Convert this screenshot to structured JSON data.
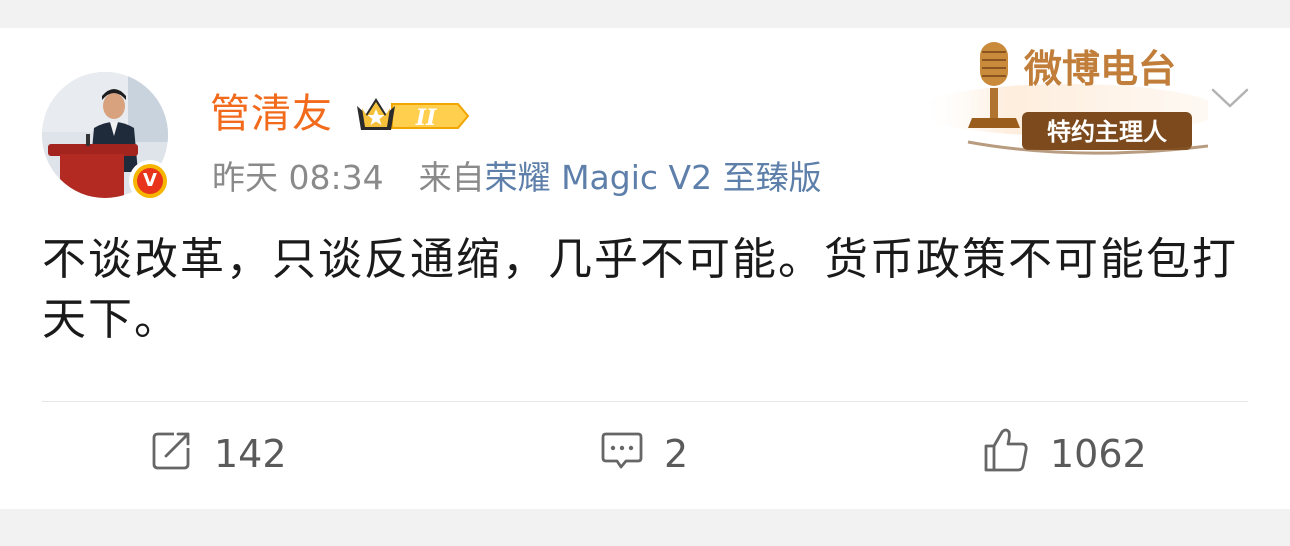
{
  "post": {
    "username": "管清友",
    "time": "昨天 08:34",
    "source_prefix": "来自",
    "source_device": "荣耀 Magic V2 至臻版",
    "text": "不谈改革，只谈反通缩，几乎不可能。货币政策不可能包打天下。",
    "badge_level": "II",
    "verified_mark": "V",
    "radio_badge": {
      "title": "微博电台",
      "subtitle": "特约主理人"
    }
  },
  "actions": {
    "repost_count": "142",
    "comment_count": "2",
    "like_count": "1062"
  },
  "icons": {
    "avatar": "avatar-photo",
    "verified": "verified-v-icon",
    "level": "crown-level-icon",
    "radio": "microphone-icon",
    "menu": "chevron-down-icon",
    "repost": "share-icon",
    "comment": "comment-icon",
    "like": "thumbs-up-icon"
  },
  "colors": {
    "username": "#f26b1d",
    "source_link": "#5d7fa9",
    "meta": "#8a8a8a",
    "verified": "#e8341a",
    "radio_badge": "#8b5a2b"
  }
}
